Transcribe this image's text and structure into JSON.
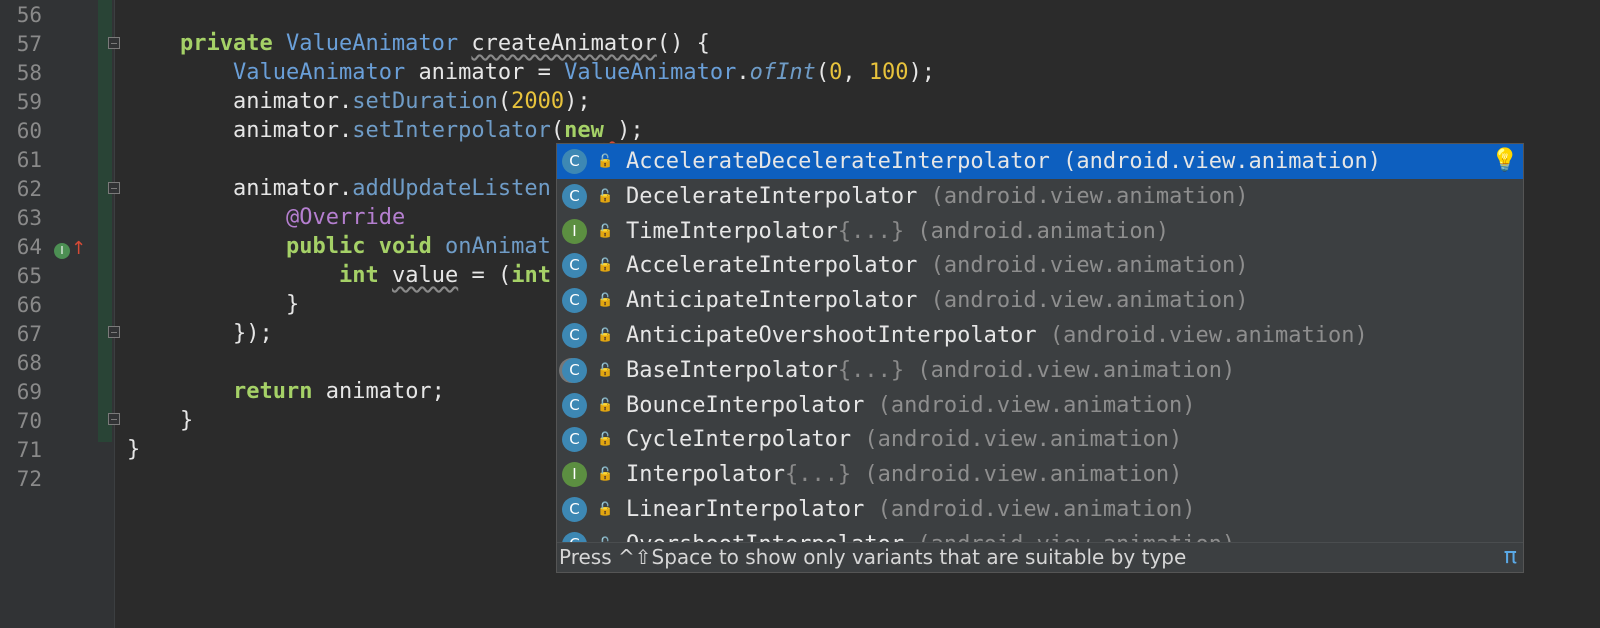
{
  "editor": {
    "line_numbers": [
      "56",
      "57",
      "58",
      "59",
      "60",
      "61",
      "62",
      "63",
      "64",
      "65",
      "66",
      "67",
      "68",
      "69",
      "70",
      "71",
      "72"
    ],
    "lines": [
      {
        "n": 57,
        "indent": 2,
        "tokens": [
          {
            "t": "private ",
            "c": "kw"
          },
          {
            "t": "ValueAnimator ",
            "c": "type"
          },
          {
            "t": "createAnimator",
            "c": "plain squiggle"
          },
          {
            "t": "() {",
            "c": "plain"
          }
        ]
      },
      {
        "n": 58,
        "indent": 4,
        "tokens": [
          {
            "t": "ValueAnimator ",
            "c": "type"
          },
          {
            "t": "animator = ",
            "c": "plain"
          },
          {
            "t": "ValueAnimator",
            "c": "type"
          },
          {
            "t": ".",
            "c": "plain"
          },
          {
            "t": "ofInt",
            "c": "static"
          },
          {
            "t": "(",
            "c": "plain"
          },
          {
            "t": "0",
            "c": "num"
          },
          {
            "t": ", ",
            "c": "plain"
          },
          {
            "t": "100",
            "c": "num"
          },
          {
            "t": ");",
            "c": "plain"
          }
        ]
      },
      {
        "n": 59,
        "indent": 4,
        "tokens": [
          {
            "t": "animator.",
            "c": "plain"
          },
          {
            "t": "setDuration",
            "c": "method"
          },
          {
            "t": "(",
            "c": "plain"
          },
          {
            "t": "2000",
            "c": "num"
          },
          {
            "t": ");",
            "c": "plain"
          }
        ]
      },
      {
        "n": 60,
        "indent": 4,
        "tokens": [
          {
            "t": "animator.",
            "c": "plain"
          },
          {
            "t": "setInterpolator",
            "c": "method"
          },
          {
            "t": "(",
            "c": "plain"
          },
          {
            "t": "new",
            "c": "kw"
          },
          {
            "t": " ",
            "c": "plain err"
          },
          {
            "t": ");",
            "c": "plain"
          }
        ]
      },
      {
        "n": 62,
        "indent": 4,
        "tokens": [
          {
            "t": "animator.",
            "c": "plain"
          },
          {
            "t": "addUpdateListen",
            "c": "method"
          }
        ]
      },
      {
        "n": 63,
        "indent": 6,
        "tokens": [
          {
            "t": "@Override",
            "c": "ann"
          }
        ]
      },
      {
        "n": 64,
        "indent": 6,
        "tokens": [
          {
            "t": "public void ",
            "c": "kw"
          },
          {
            "t": "onAnimat",
            "c": "method"
          }
        ]
      },
      {
        "n": 65,
        "indent": 8,
        "tokens": [
          {
            "t": "int ",
            "c": "kw"
          },
          {
            "t": "value",
            "c": "plain squiggle"
          },
          {
            "t": " = (",
            "c": "plain"
          },
          {
            "t": "int",
            "c": "kw"
          }
        ]
      },
      {
        "n": 66,
        "indent": 6,
        "tokens": [
          {
            "t": "}",
            "c": "plain"
          }
        ]
      },
      {
        "n": 67,
        "indent": 4,
        "tokens": [
          {
            "t": "});",
            "c": "plain"
          }
        ]
      },
      {
        "n": 69,
        "indent": 4,
        "tokens": [
          {
            "t": "return ",
            "c": "kw"
          },
          {
            "t": "animator;",
            "c": "plain"
          }
        ]
      },
      {
        "n": 70,
        "indent": 2,
        "tokens": [
          {
            "t": "}",
            "c": "plain"
          }
        ]
      },
      {
        "n": 71,
        "indent": 0,
        "tokens": [
          {
            "t": "}",
            "c": "plain"
          }
        ]
      }
    ]
  },
  "completion": {
    "items": [
      {
        "kind": "class",
        "badge": "C",
        "name": "AccelerateDecelerateInterpolator",
        "suffix": "",
        "package": "(android.view.animation)",
        "selected": true
      },
      {
        "kind": "class",
        "badge": "C",
        "name": "DecelerateInterpolator",
        "suffix": "",
        "package": "(android.view.animation)"
      },
      {
        "kind": "interface",
        "badge": "I",
        "name": "TimeInterpolator",
        "suffix": "{...}",
        "package": "(android.animation)"
      },
      {
        "kind": "class",
        "badge": "C",
        "name": "AccelerateInterpolator",
        "suffix": "",
        "package": "(android.view.animation)"
      },
      {
        "kind": "class",
        "badge": "C",
        "name": "AnticipateInterpolator",
        "suffix": "",
        "package": "(android.view.animation)"
      },
      {
        "kind": "class",
        "badge": "C",
        "name": "AnticipateOvershootInterpolator",
        "suffix": "",
        "package": "(android.view.animation)"
      },
      {
        "kind": "abstract",
        "badge": "C",
        "name": "BaseInterpolator",
        "suffix": "{...}",
        "package": "(android.view.animation)"
      },
      {
        "kind": "class",
        "badge": "C",
        "name": "BounceInterpolator",
        "suffix": "",
        "package": "(android.view.animation)"
      },
      {
        "kind": "class",
        "badge": "C",
        "name": "CycleInterpolator",
        "suffix": "",
        "package": "(android.view.animation)"
      },
      {
        "kind": "interface",
        "badge": "I",
        "name": "Interpolator",
        "suffix": "{...}",
        "package": "(android.view.animation)"
      },
      {
        "kind": "class",
        "badge": "C",
        "name": "LinearInterpolator",
        "suffix": "",
        "package": "(android.view.animation)"
      },
      {
        "kind": "class",
        "badge": "C",
        "name": "OvershootInterpolator",
        "suffix": "",
        "package": "(android.view.animation)"
      }
    ],
    "footer_hint": "Press ^⇧Space to show only variants that are suitable by type",
    "footer_symbol": "π"
  },
  "icons": {
    "override": "override-implements-icon",
    "bulb": "lightbulb-icon",
    "lock": "public-access-icon"
  },
  "colors": {
    "selection": "#0d5fbf",
    "keyword": "#a5d167",
    "number": "#e8c33c",
    "type": "#6a9fd8"
  }
}
